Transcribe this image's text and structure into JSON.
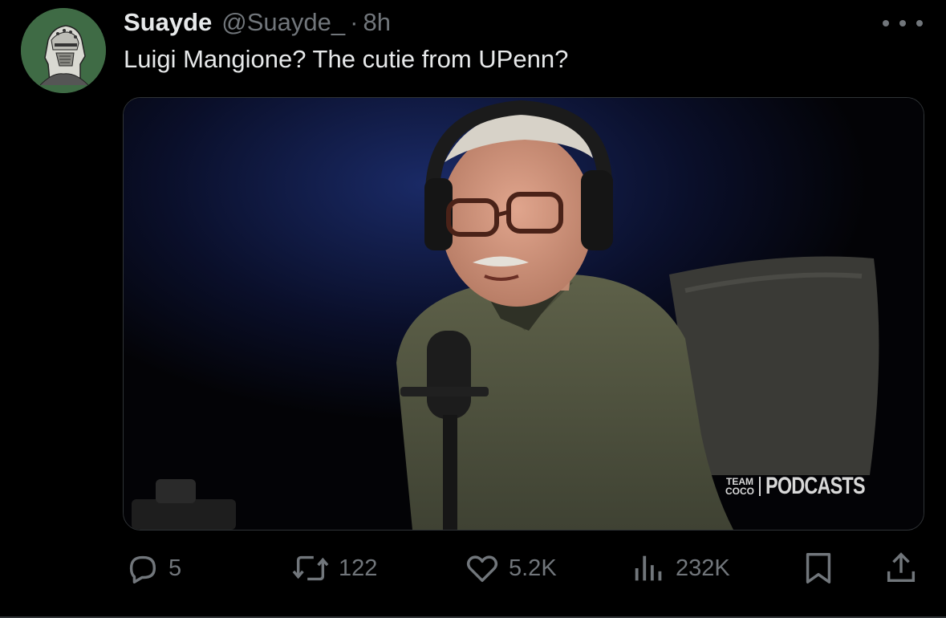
{
  "tweet": {
    "author": {
      "display_name": "Suayde",
      "handle": "@Suayde_",
      "avatar_icon": "knight-helmet-avatar"
    },
    "separator": "·",
    "timestamp": "8h",
    "text": "Luigi Mangione? The cutie from UPenn?",
    "more_icon": "more-dots-icon",
    "media": {
      "type": "video",
      "watermark_team": [
        "TEAM",
        "COCO"
      ],
      "watermark_brand": "PODCASTS"
    },
    "actions": {
      "reply": {
        "icon": "reply-bubble-icon",
        "count": "5"
      },
      "retweet": {
        "icon": "retweet-icon",
        "count": "122"
      },
      "like": {
        "icon": "heart-icon",
        "count": "5.2K"
      },
      "views": {
        "icon": "views-bars-icon",
        "count": "232K"
      },
      "bookmark": {
        "icon": "bookmark-icon"
      },
      "share": {
        "icon": "share-icon"
      }
    }
  },
  "colors": {
    "background": "#000000",
    "text_primary": "#e7e9ea",
    "text_secondary": "#71767b",
    "border": "#2f3336",
    "avatar_bg": "#3f6b45"
  }
}
